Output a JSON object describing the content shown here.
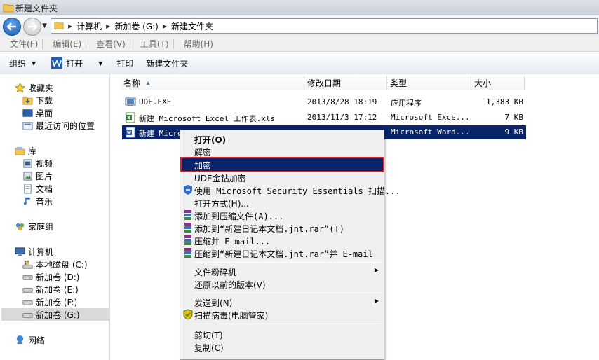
{
  "window": {
    "title": "新建文件夹"
  },
  "address": {
    "crumbs": [
      "计算机",
      "新加卷 (G:)",
      "新建文件夹"
    ]
  },
  "menubar": {
    "items": [
      "文件(F)",
      "编辑(E)",
      "查看(V)",
      "工具(T)",
      "帮助(H)"
    ]
  },
  "toolbar": {
    "organize": "组织",
    "open": "打开",
    "print": "打印",
    "new_folder": "新建文件夹"
  },
  "navpane": {
    "favorites": "收藏夹",
    "favorites_items": [
      "下载",
      "桌面",
      "最近访问的位置"
    ],
    "libraries": "库",
    "library_items": [
      "视频",
      "图片",
      "文档",
      "音乐"
    ],
    "homegroup": "家庭组",
    "computer": "计算机",
    "drives": [
      "本地磁盘 (C:)",
      "新加卷 (D:)",
      "新加卷 (E:)",
      "新加卷 (F:)",
      "新加卷 (G:)"
    ],
    "network": "网络"
  },
  "columns": [
    "名称",
    "修改日期",
    "类型",
    "大小"
  ],
  "files": [
    {
      "name": "UDE.EXE",
      "date": "2013/8/28 18:19",
      "type": "应用程序",
      "size": "1,383 KB",
      "icon": "exe-icon"
    },
    {
      "name": "新建 Microsoft Excel 工作表.xls",
      "date": "2013/11/3 17:12",
      "type": "Microsoft Exce...",
      "size": "7 KB",
      "icon": "excel-icon"
    },
    {
      "name": "新建 Micro",
      "date": "",
      "type": "Microsoft Word...",
      "size": "9 KB",
      "icon": "word-icon"
    }
  ],
  "context_menu": {
    "open": "打开(O)",
    "decrypt": "解密",
    "encrypt": "加密",
    "ude_encrypt": "UDE金钻加密",
    "mse_scan": "使用 Microsoft Security Essentials 扫描...",
    "open_with": "打开方式(H)...",
    "add_archive": "添加到压缩文件(A)...",
    "add_to_rar": "添加到“新建日记本文档.jnt.rar”(T)",
    "compress_email": "压缩并 E-mail...",
    "compress_rar_email": "压缩到“新建日记本文档.jnt.rar”并 E-mail",
    "shredder": "文件粉碎机",
    "restore": "还原以前的版本(V)",
    "send_to": "发送到(N)",
    "scan_virus": "扫描病毒(电脑管家)",
    "cut": "剪切(T)",
    "copy": "复制(C)"
  }
}
